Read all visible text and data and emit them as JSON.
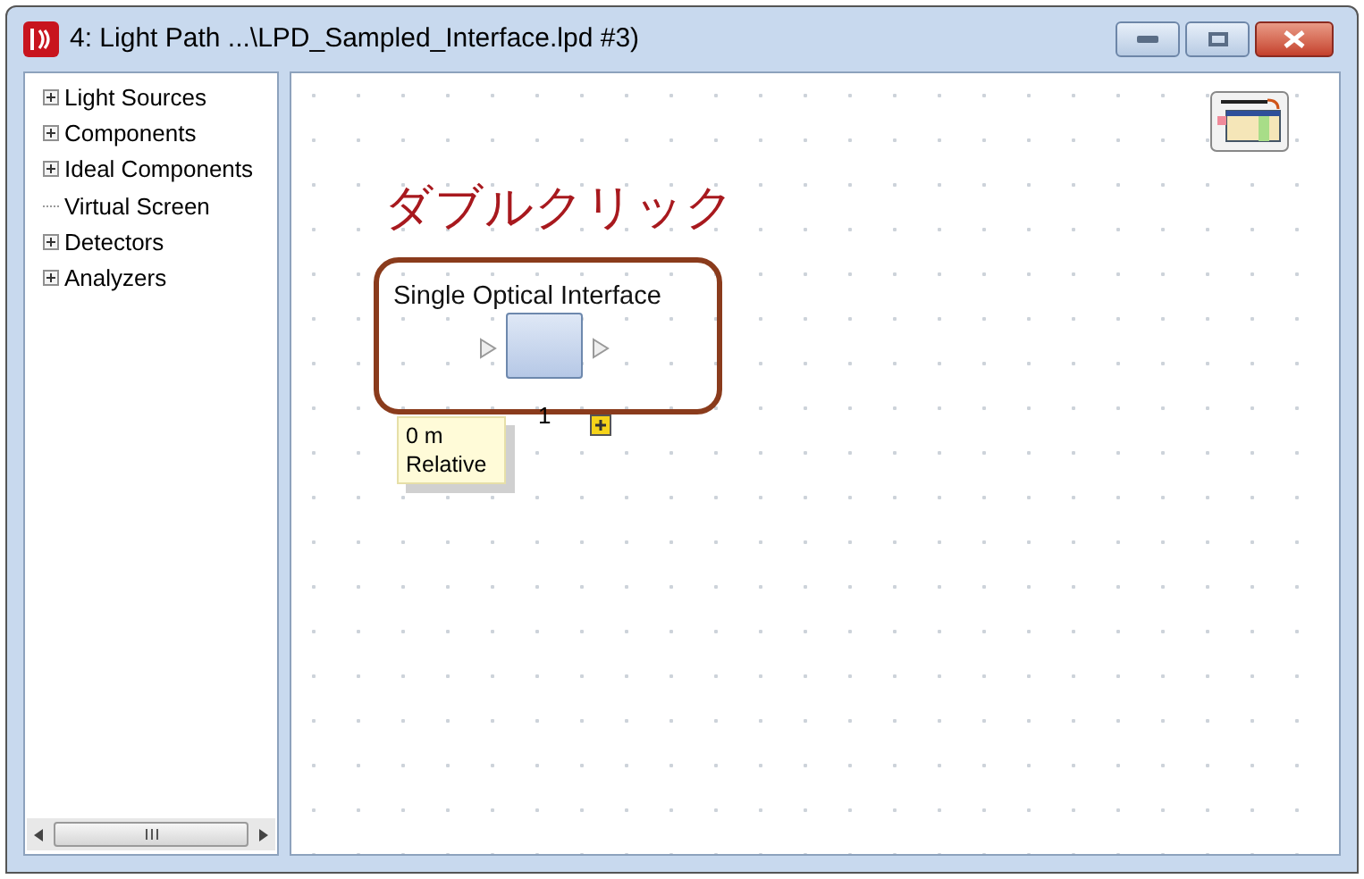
{
  "window": {
    "title": "4: Light Path ...\\LPD_Sampled_Interface.lpd #3)"
  },
  "tree": {
    "items": [
      {
        "label": "Light Sources",
        "expandable": true
      },
      {
        "label": "Components",
        "expandable": true
      },
      {
        "label": "Ideal Components",
        "expandable": true
      },
      {
        "label": "Virtual Screen",
        "expandable": false
      },
      {
        "label": "Detectors",
        "expandable": true
      },
      {
        "label": "Analyzers",
        "expandable": true
      }
    ]
  },
  "canvas": {
    "annotation": "ダブルクリック",
    "component": {
      "title": "Single Optical Interface",
      "port_label": "1"
    },
    "tooltip": [
      "0 m",
      "Relative"
    ]
  }
}
